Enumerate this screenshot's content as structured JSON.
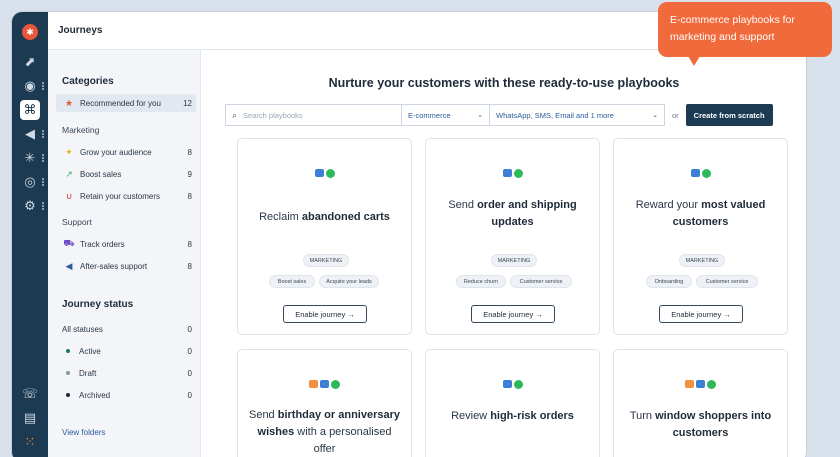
{
  "app": {
    "title": "Journeys"
  },
  "callout": {
    "text": "E-commerce playbooks for marketing and support"
  },
  "sidebar": {
    "categories_heading": "Categories",
    "recommended": {
      "label": "Recommended for you",
      "count": "12"
    },
    "marketing_heading": "Marketing",
    "marketing_items": [
      {
        "label": "Grow your audience",
        "count": "8"
      },
      {
        "label": "Boost sales",
        "count": "9"
      },
      {
        "label": "Retain your customers",
        "count": "8"
      }
    ],
    "support_heading": "Support",
    "support_items": [
      {
        "label": "Track orders",
        "count": "8"
      },
      {
        "label": "After-sales support",
        "count": "8"
      }
    ],
    "status_heading": "Journey status",
    "statuses": [
      {
        "label": "All statuses",
        "count": "0"
      },
      {
        "label": "Active",
        "count": "0",
        "color": "#1f7a4d"
      },
      {
        "label": "Draft",
        "count": "0",
        "color": "#7fa08e"
      },
      {
        "label": "Archived",
        "count": "0",
        "color": "#1f2b3a"
      }
    ],
    "view_folders": "View folders"
  },
  "main": {
    "title": "Nurture your customers with these ready-to-use playbooks",
    "search_placeholder": "Search playbooks",
    "industry": "E-commerce",
    "channels": "WhatsApp, SMS, Email and 1 more",
    "or": "or",
    "create": "Create from scratch",
    "enable_label": "Enable journey →",
    "marketing_tag": "MARKETING",
    "cards": [
      {
        "pre": "Reclaim ",
        "bold": "abandoned carts",
        "post": "",
        "tags": [
          "Boost sales",
          "Acquire your leads"
        ]
      },
      {
        "pre": "Send ",
        "bold": "order and shipping updates",
        "post": "",
        "tags": [
          "Reduce churn",
          "Customer service"
        ]
      },
      {
        "pre": "Reward your ",
        "bold": "most valued customers",
        "post": "",
        "tags": [
          "Onboarding",
          "Customer service"
        ]
      },
      {
        "pre": "Send ",
        "bold": "birthday or anniversary wishes",
        "post": " with a personalised offer"
      },
      {
        "pre": "Review ",
        "bold": "high-risk orders",
        "post": ""
      },
      {
        "pre": "Turn ",
        "bold": "window shoppers into customers",
        "post": ""
      }
    ]
  },
  "colors": {
    "accent": "#1c3a52",
    "callout": "#f06a3b",
    "whatsapp": "#2fb85a",
    "sms": "#3d7fd6",
    "email": "#f0913c"
  }
}
